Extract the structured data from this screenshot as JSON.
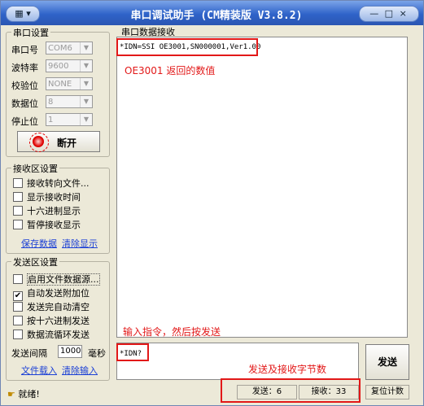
{
  "window": {
    "title": "串口调试助手 (CM精装版 V3.8.2)",
    "sysmenu": "▾",
    "controls": "— □ ×"
  },
  "serial_settings": {
    "title": "串口设置",
    "port_label": "串口号",
    "port_value": "COM6",
    "baud_label": "波特率",
    "baud_value": "9600",
    "parity_label": "校验位",
    "parity_value": "NONE",
    "databits_label": "数据位",
    "databits_value": "8",
    "stopbits_label": "停止位",
    "stopbits_value": "1",
    "toggle_label": "断开"
  },
  "receive_settings": {
    "title": "接收区设置",
    "options": [
      "接收转向文件...",
      "显示接收时间",
      "十六进制显示",
      "暂停接收显示"
    ],
    "save_link": "保存数据",
    "clear_link": "清除显示"
  },
  "send_settings": {
    "title": "发送区设置",
    "options": [
      "启用文件数据源...",
      "自动发送附加位",
      "发送完自动清空",
      "按十六进制发送",
      "数据流循环发送"
    ],
    "option_checked": [
      false,
      true,
      false,
      false,
      false
    ],
    "interval_label": "发送间隔",
    "interval_value": "1000",
    "interval_unit": "毫秒",
    "load_link": "文件载入",
    "clear_link": "清除输入"
  },
  "receive_area": {
    "title": "串口数据接收",
    "content": "*IDN=SSI OE3001,SN000001,Ver1.00"
  },
  "send_area": {
    "content": "*IDN?"
  },
  "send_button": "发送",
  "annotations": {
    "reply": "OE3001 返回的数值",
    "input_hint": "输入指令，然后按发送",
    "count_hint": "发送及接收字节数"
  },
  "status": {
    "ready": "就绪!",
    "sent": "发送：6",
    "received": "接收：33",
    "reset": "复位计数"
  },
  "colors": {
    "annotation": "#e21818",
    "titlebar": "#2f63c9",
    "link": "#1a3fd6"
  }
}
